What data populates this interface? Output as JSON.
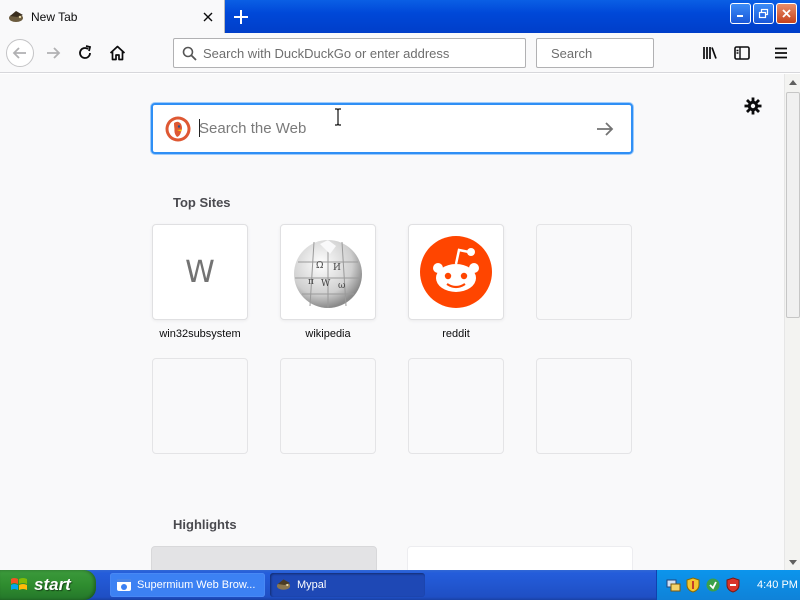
{
  "browser": {
    "tab": {
      "title": "New Tab",
      "favicon": "mypal-icon",
      "close_icon": "close-icon"
    },
    "new_tab_icon": "plus-icon",
    "window_controls": [
      "minimize-icon",
      "restore-icon",
      "close-icon"
    ],
    "nav": {
      "back_icon": "back-arrow-icon",
      "forward_icon": "forward-arrow-icon",
      "reload_icon": "reload-icon",
      "home_icon": "home-icon",
      "address_placeholder": "Search with DuckDuckGo or enter address",
      "search_placeholder": "Search",
      "library_icon": "library-icon",
      "sidebar_icon": "sidebar-icon",
      "menu_icon": "hamburger-menu-icon"
    }
  },
  "newtab": {
    "settings_icon": "gear-icon",
    "web_search": {
      "placeholder": "Search the Web",
      "engine": "DuckDuckGo",
      "go_icon": "arrow-right-icon"
    },
    "top_sites_title": "Top Sites",
    "top_sites": [
      {
        "label": "win32subsystem",
        "letter": "W",
        "icon": "letter-w"
      },
      {
        "label": "wikipedia",
        "icon": "wikipedia-globe-icon"
      },
      {
        "label": "reddit",
        "icon": "reddit-alien-icon"
      },
      {
        "label": ""
      },
      {
        "label": ""
      },
      {
        "label": ""
      },
      {
        "label": ""
      },
      {
        "label": ""
      }
    ],
    "highlights_title": "Highlights"
  },
  "taskbar": {
    "start_label": "start",
    "tasks": [
      {
        "label": "Supermium Web Brow...",
        "icon": "supermium-icon",
        "active": false
      },
      {
        "label": "Mypal",
        "icon": "mypal-icon",
        "active": true
      }
    ],
    "tray_icons": [
      "network-icon",
      "security-shield-icon",
      "update-icon",
      "antivirus-icon"
    ],
    "clock": "4:40 PM"
  },
  "colors": {
    "accent_blue": "#2f8ff5",
    "titlebar_blue": "#0048d8",
    "reddit_orange": "#ff4500",
    "ddg_orange": "#de5833",
    "start_green": "#2f8d2f"
  }
}
